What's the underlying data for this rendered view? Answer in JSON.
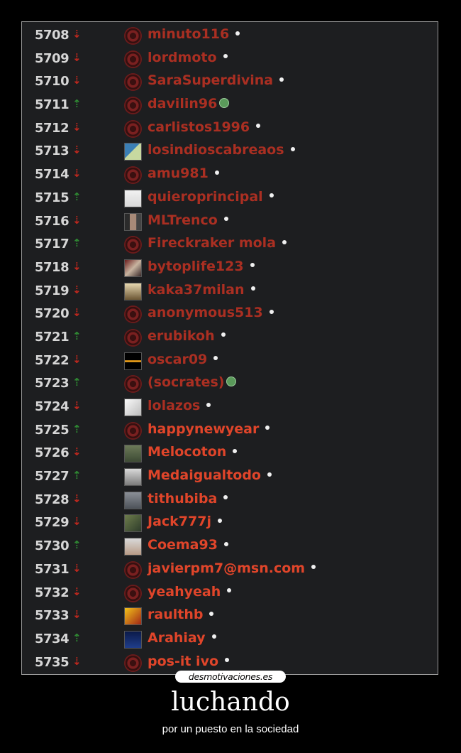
{
  "list": [
    {
      "rank": "5708",
      "trend": "down",
      "user": "minuto116",
      "avatar": "default-avatar",
      "status": "offline"
    },
    {
      "rank": "5709",
      "trend": "down",
      "user": "lordmoto",
      "avatar": "default-avatar",
      "status": "offline"
    },
    {
      "rank": "5710",
      "trend": "down",
      "user": "SaraSuperdivina",
      "avatar": "default-avatar",
      "status": "offline"
    },
    {
      "rank": "5711",
      "trend": "up",
      "user": "davilin96",
      "avatar": "default-avatar",
      "status": "online"
    },
    {
      "rank": "5712",
      "trend": "down",
      "user": "carlistos1996",
      "avatar": "default-avatar",
      "status": "offline"
    },
    {
      "rank": "5713",
      "trend": "down",
      "user": "losindioscabreaos",
      "avatar": "photo-avatar",
      "status": "offline"
    },
    {
      "rank": "5714",
      "trend": "down",
      "user": "amu981",
      "avatar": "default-avatar",
      "status": "offline"
    },
    {
      "rank": "5715",
      "trend": "up",
      "user": "quieroprincipal",
      "avatar": "photo-avatar",
      "status": "offline"
    },
    {
      "rank": "5716",
      "trend": "down",
      "user": "MLTrenco",
      "avatar": "photo-avatar",
      "status": "offline"
    },
    {
      "rank": "5717",
      "trend": "up",
      "user": "Fireckraker mola",
      "avatar": "default-avatar",
      "status": "offline"
    },
    {
      "rank": "5718",
      "trend": "down",
      "user": "bytoplife123",
      "avatar": "photo-avatar",
      "status": "offline"
    },
    {
      "rank": "5719",
      "trend": "down",
      "user": "kaka37milan",
      "avatar": "photo-avatar",
      "status": "offline"
    },
    {
      "rank": "5720",
      "trend": "down",
      "user": "anonymous513",
      "avatar": "default-avatar",
      "status": "offline"
    },
    {
      "rank": "5721",
      "trend": "up",
      "user": "erubikoh",
      "avatar": "default-avatar",
      "status": "offline"
    },
    {
      "rank": "5722",
      "trend": "down",
      "user": "oscar09",
      "avatar": "photo-avatar",
      "status": "offline"
    },
    {
      "rank": "5723",
      "trend": "up",
      "user": "(socrates)",
      "avatar": "default-avatar",
      "status": "online"
    },
    {
      "rank": "5724",
      "trend": "down",
      "user": "lolazos",
      "avatar": "photo-avatar",
      "status": "offline"
    },
    {
      "rank": "5725",
      "trend": "up",
      "user": "happynewyear",
      "avatar": "default-avatar",
      "status": "offline"
    },
    {
      "rank": "5726",
      "trend": "down",
      "user": "Melocoton",
      "avatar": "photo-avatar",
      "status": "offline"
    },
    {
      "rank": "5727",
      "trend": "up",
      "user": "Medaigualtodo",
      "avatar": "photo-avatar",
      "status": "offline"
    },
    {
      "rank": "5728",
      "trend": "down",
      "user": "tithubiba",
      "avatar": "photo-avatar",
      "status": "offline"
    },
    {
      "rank": "5729",
      "trend": "down",
      "user": "Jack777j",
      "avatar": "photo-avatar",
      "status": "offline"
    },
    {
      "rank": "5730",
      "trend": "up",
      "user": "Coema93",
      "avatar": "photo-avatar",
      "status": "offline"
    },
    {
      "rank": "5731",
      "trend": "down",
      "user": "javierpm7@msn.com",
      "avatar": "default-avatar",
      "status": "offline"
    },
    {
      "rank": "5732",
      "trend": "down",
      "user": "yeahyeah",
      "avatar": "default-avatar",
      "status": "offline"
    },
    {
      "rank": "5733",
      "trend": "down",
      "user": "raulthb",
      "avatar": "photo-avatar",
      "status": "offline"
    },
    {
      "rank": "5734",
      "trend": "up",
      "user": "Arahiay",
      "avatar": "photo-avatar",
      "status": "offline"
    },
    {
      "rank": "5735",
      "trend": "down",
      "user": "pos-it ivo",
      "avatar": "default-avatar",
      "status": "offline"
    }
  ],
  "watermark": "desmotivaciones.es",
  "title": "luchando",
  "subtitle": "por un puesto en la sociedad",
  "colors": {
    "down": "#c0281e",
    "up": "#2f8a33",
    "username": "#e0452a",
    "background": "#000000",
    "panel": "#1d1e20"
  }
}
